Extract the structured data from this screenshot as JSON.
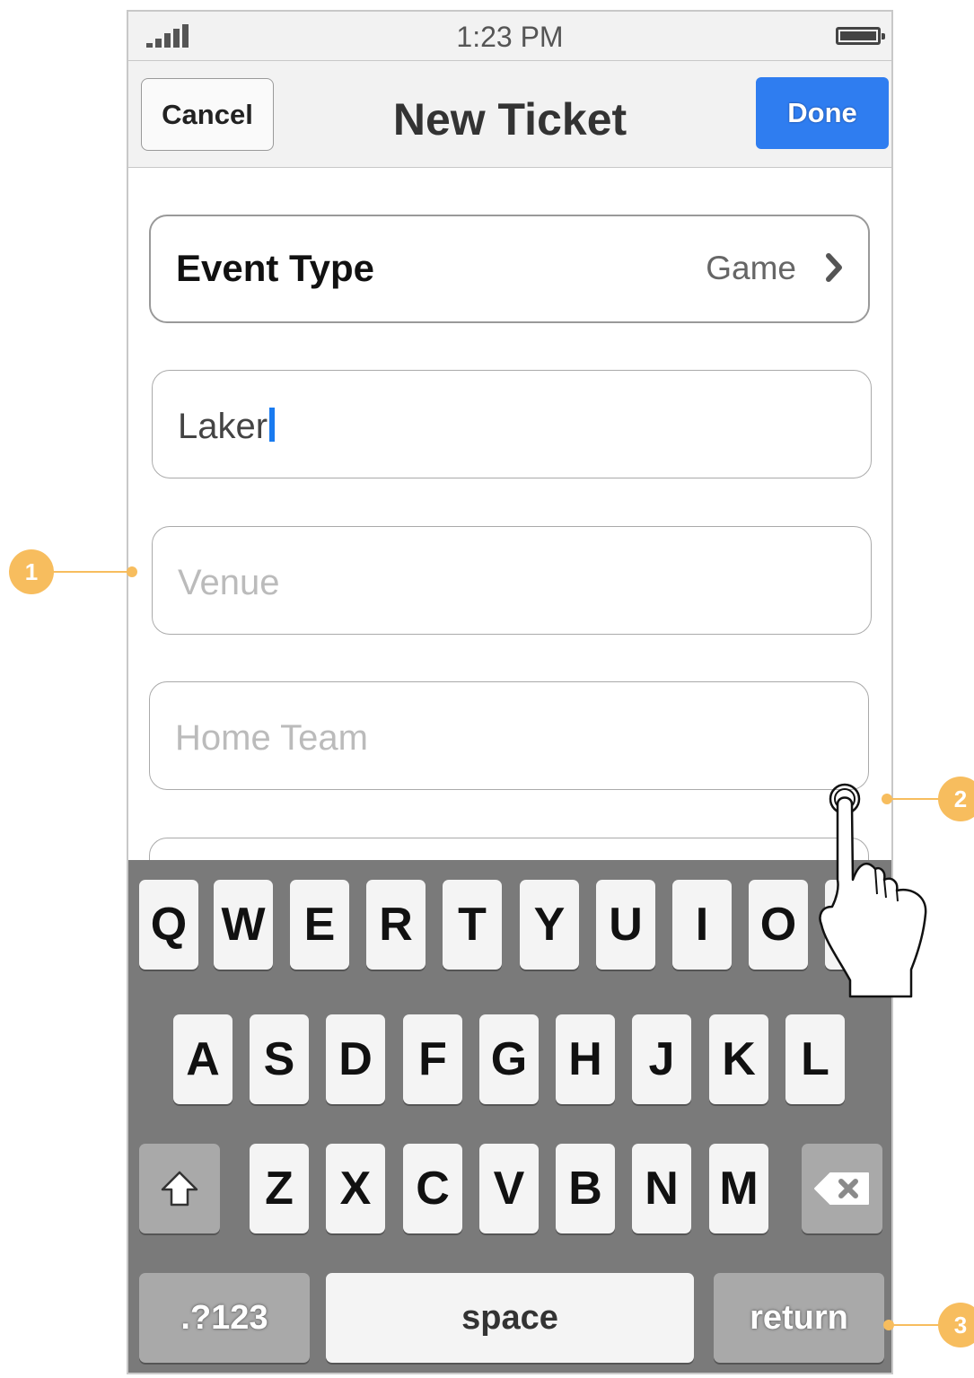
{
  "status_bar": {
    "time": "1:23 PM"
  },
  "nav": {
    "cancel_label": "Cancel",
    "title": "New Ticket",
    "done_label": "Done"
  },
  "form": {
    "event_type": {
      "label": "Event Type",
      "value": "Game"
    },
    "name_field": {
      "value": "Laker"
    },
    "venue_field": {
      "placeholder": "Venue"
    },
    "home_team_field": {
      "placeholder": "Home Team"
    }
  },
  "keyboard": {
    "row1": [
      "Q",
      "W",
      "E",
      "R",
      "T",
      "Y",
      "U",
      "I",
      "O"
    ],
    "row2": [
      "A",
      "S",
      "D",
      "F",
      "G",
      "H",
      "J",
      "K",
      "L"
    ],
    "row3": [
      "Z",
      "X",
      "C",
      "V",
      "B",
      "N",
      "M"
    ],
    "numbers_label": ".?123",
    "space_label": "space",
    "return_label": "return"
  },
  "annotations": [
    "1",
    "2",
    "3"
  ],
  "colors": {
    "accent": "#2f7df0",
    "annotation": "#f7bd5e",
    "keyboard_bg": "#7a7a7a"
  }
}
